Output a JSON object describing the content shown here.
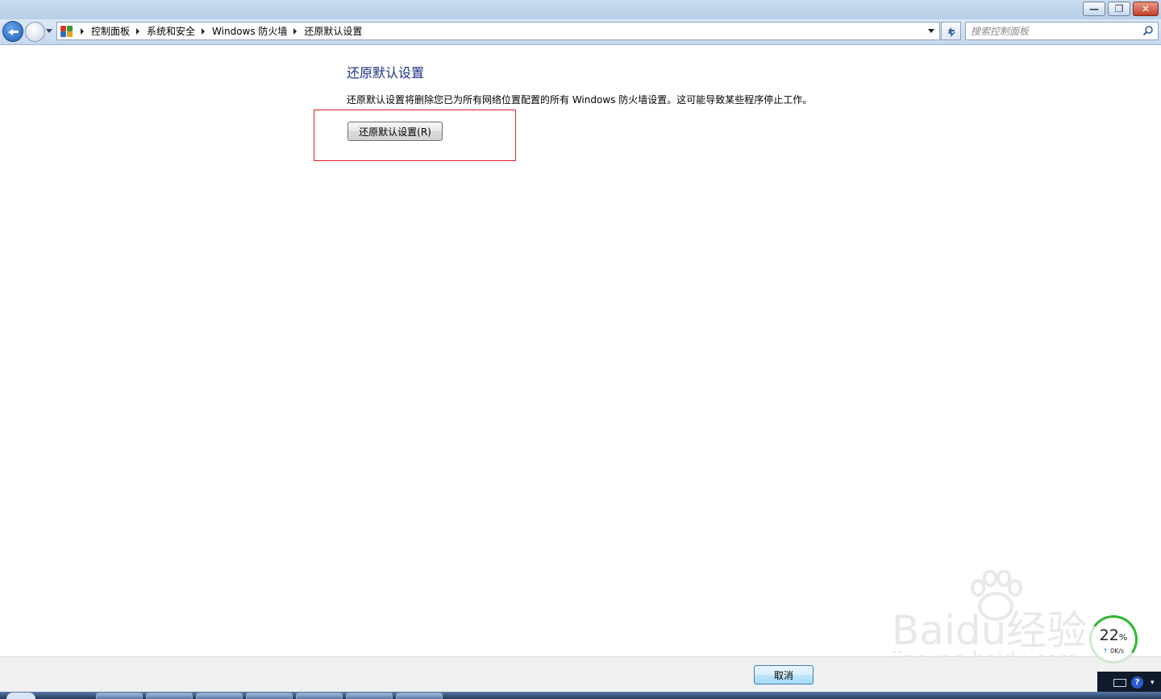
{
  "window": {
    "minimize_label": "—",
    "maximize_label": "❐",
    "close_label": "✕"
  },
  "address_bar": {
    "breadcrumbs": [
      "控制面板",
      "系统和安全",
      "Windows 防火墙",
      "还原默认设置"
    ]
  },
  "search": {
    "placeholder": "搜索控制面板"
  },
  "main": {
    "heading": "还原默认设置",
    "description": "还原默认设置将删除您已为所有网络位置配置的所有 Windows 防火墙设置。这可能导致某些程序停止工作。",
    "restore_button_label": "还原默认设置(R)"
  },
  "footer": {
    "cancel_label": "取消"
  },
  "network_widget": {
    "percent": "22",
    "percent_unit": "%",
    "speed": "0K/s",
    "arrow": "↑"
  },
  "watermark": {
    "brand": "Baidu经验",
    "url": "jingyan.baidu.com"
  },
  "colors": {
    "heading": "#1e3287",
    "highlight_border": "#e0202a",
    "ring": "#2eb82e"
  }
}
